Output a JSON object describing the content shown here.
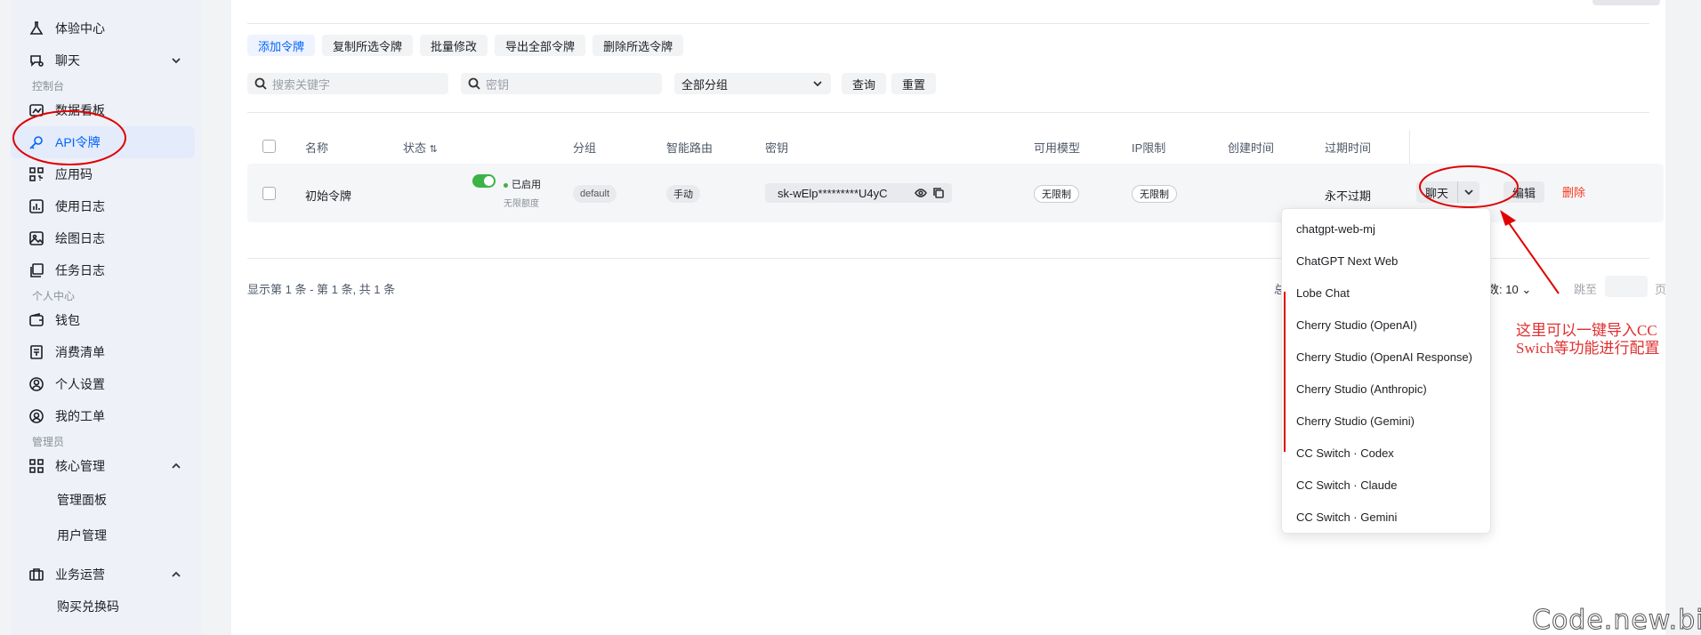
{
  "sidebar": {
    "items": [
      {
        "label": "体验中心",
        "icon": "flask-icon"
      },
      {
        "label": "聊天",
        "icon": "chat-icon"
      }
    ],
    "console_label": "控制台",
    "console_items": [
      {
        "label": "数据看板",
        "icon": "dashboard-icon"
      },
      {
        "label": "API令牌",
        "icon": "key-icon"
      },
      {
        "label": "应用码",
        "icon": "qrcode-icon"
      },
      {
        "label": "使用日志",
        "icon": "chart-icon"
      },
      {
        "label": "绘图日志",
        "icon": "image-icon"
      },
      {
        "label": "任务日志",
        "icon": "task-icon"
      }
    ],
    "personal_label": "个人中心",
    "personal_items": [
      {
        "label": "钱包",
        "icon": "wallet-icon"
      },
      {
        "label": "消费清单",
        "icon": "receipt-icon"
      },
      {
        "label": "个人设置",
        "icon": "user-settings-icon"
      },
      {
        "label": "我的工单",
        "icon": "ticket-icon"
      }
    ],
    "admin_label": "管理员",
    "admin_core": {
      "label": "核心管理",
      "icon": "grid-icon",
      "subs": [
        "管理面板",
        "用户管理"
      ]
    },
    "admin_ops": {
      "label": "业务运营",
      "icon": "briefcase-icon",
      "subs": [
        "购买兑换码"
      ]
    }
  },
  "toolbar": {
    "add": "添加令牌",
    "copy": "复制所选令牌",
    "batch": "批量修改",
    "export": "导出全部令牌",
    "delete": "删除所选令牌"
  },
  "filters": {
    "keyword_placeholder": "搜索关键字",
    "key_placeholder": "密钥",
    "group_value": "全部分组",
    "query": "查询",
    "reset": "重置"
  },
  "table": {
    "headers": {
      "name": "名称",
      "status": "状态",
      "group": "分组",
      "routing": "智能路由",
      "key": "密钥",
      "models": "可用模型",
      "ip": "IP限制",
      "created": "创建时间",
      "expire": "过期时间"
    },
    "row": {
      "name": "初始令牌",
      "status": "已启用",
      "quota": "无限额度",
      "group": "default",
      "routing": "手动",
      "key": "sk-wElp*********U4yC",
      "models": "无限制",
      "ip": "无限制",
      "created": "",
      "expire": "永不过期",
      "chat": "聊天",
      "edit": "编辑",
      "delete": "删除"
    }
  },
  "pagination": {
    "info": "显示第 1 条 - 第 1 条, 共 1 条",
    "partial_left": "总",
    "page_size": "数: 10",
    "jump": "跳至",
    "page": "页"
  },
  "chat_dropdown": [
    "chatgpt-web-mj",
    "ChatGPT Next Web",
    "Lobe Chat",
    "Cherry Studio (OpenAI)",
    "Cherry Studio (OpenAI Response)",
    "Cherry Studio (Anthropic)",
    "Cherry Studio (Gemini)",
    "CC Switch · Codex",
    "CC Switch · Claude",
    "CC Switch · Gemini"
  ],
  "annotation": "这里可以一键导入CC\nSwich等功能进行配置",
  "watermark": "Code.new.bi",
  "colors": {
    "accent": "#0064fa",
    "annotation": "#e03030",
    "danger": "#f93920",
    "toggle_on": "#3bb346"
  }
}
